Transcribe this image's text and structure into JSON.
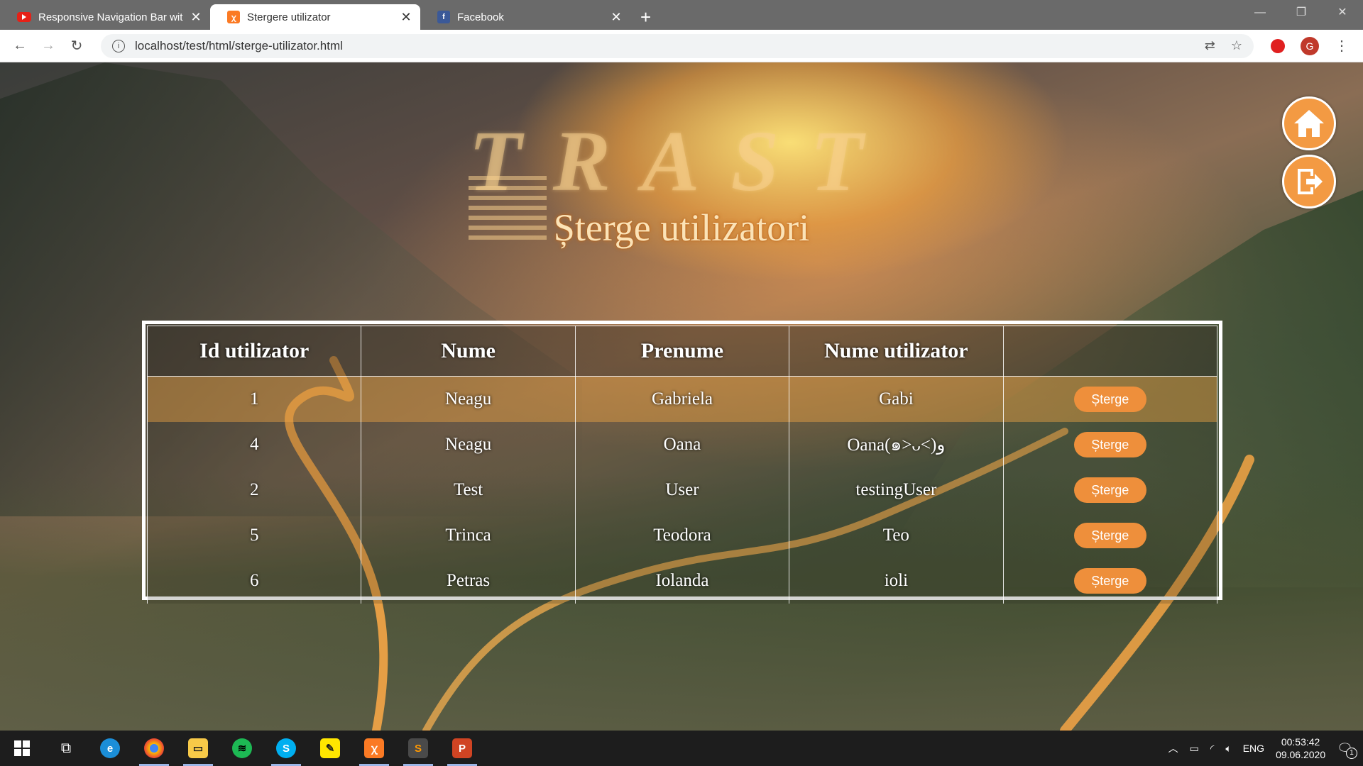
{
  "browser": {
    "tabs": [
      {
        "title": "Responsive Navigation Bar with H",
        "favicon": "youtube-icon",
        "active": false
      },
      {
        "title": "Stergere utilizator",
        "favicon": "xampp-icon",
        "active": true
      },
      {
        "title": "Facebook",
        "favicon": "facebook-icon",
        "active": false
      }
    ],
    "url": "localhost/test/html/sterge-utilizator.html",
    "profile_initial": "G"
  },
  "page": {
    "logo_text": "TRAST",
    "title": "Șterge utilizatori",
    "table": {
      "headers": [
        "Id utilizator",
        "Nume",
        "Prenume",
        "Nume utilizator",
        ""
      ],
      "rows": [
        {
          "id": "1",
          "nume": "Neagu",
          "prenume": "Gabriela",
          "user": "Gabi"
        },
        {
          "id": "4",
          "nume": "Neagu",
          "prenume": "Oana",
          "user": "Oana(๑˃ᴗ˂)ﻭ"
        },
        {
          "id": "2",
          "nume": "Test",
          "prenume": "User",
          "user": "testingUser"
        },
        {
          "id": "5",
          "nume": "Trinca",
          "prenume": "Teodora",
          "user": "Teo"
        },
        {
          "id": "6",
          "nume": "Petras",
          "prenume": "Iolanda",
          "user": "ioli"
        }
      ],
      "delete_label": "Șterge"
    },
    "accent_color": "#f39a43"
  },
  "taskbar": {
    "language": "ENG",
    "time": "00:53:42",
    "date": "09.06.2020",
    "notifications": "1"
  }
}
